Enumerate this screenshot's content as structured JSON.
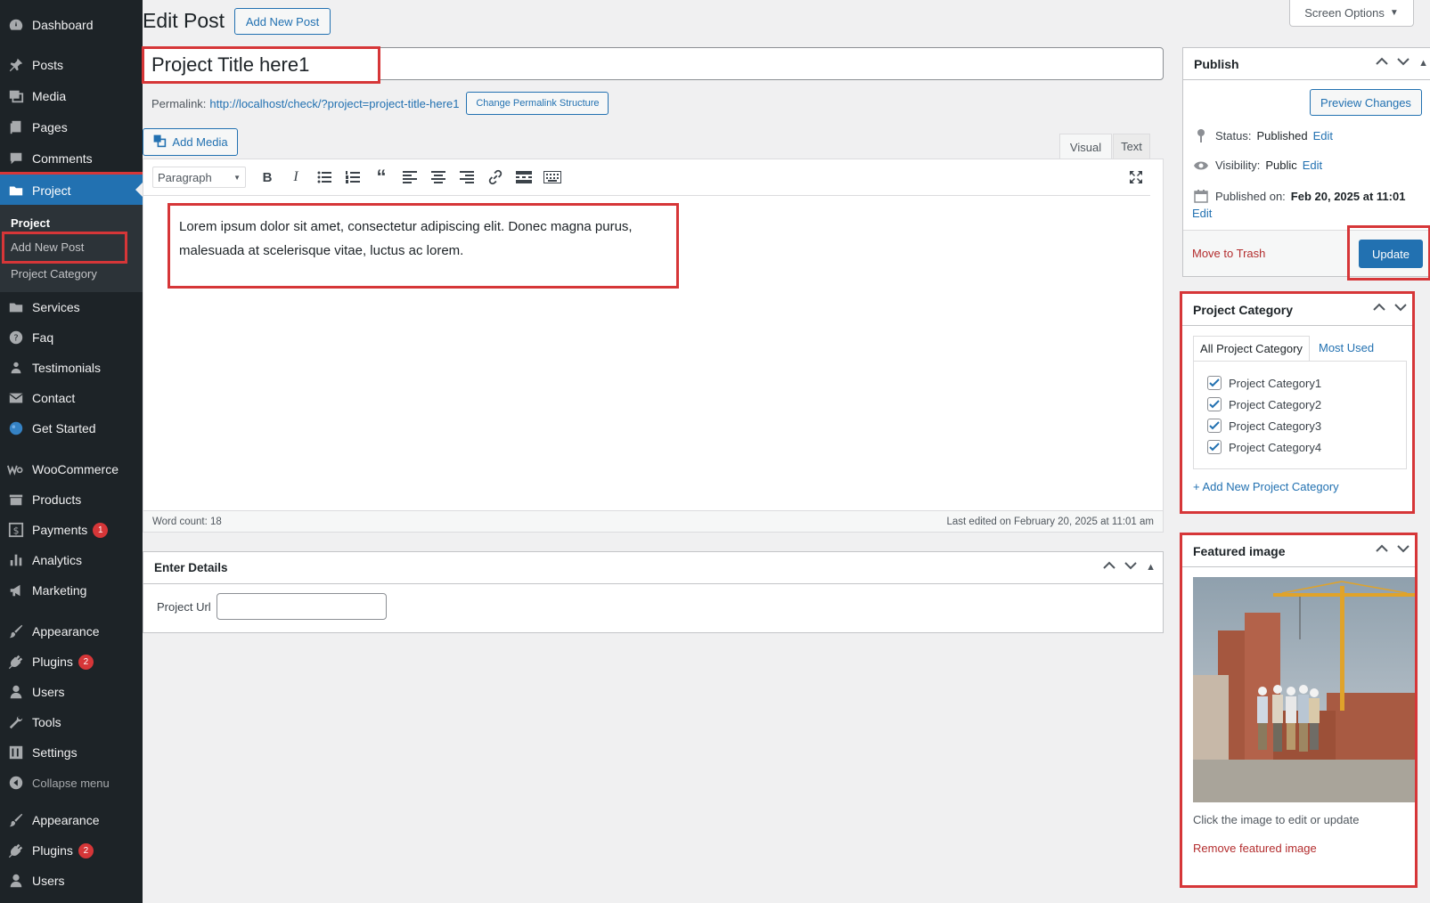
{
  "sidebar": {
    "items": [
      {
        "label": "Dashboard",
        "icon": "dashboard-icon"
      },
      {
        "label": "Posts",
        "icon": "pin-icon"
      },
      {
        "label": "Media",
        "icon": "media-icon"
      },
      {
        "label": "Pages",
        "icon": "pages-icon"
      },
      {
        "label": "Comments",
        "icon": "comment-icon"
      },
      {
        "label": "Project",
        "icon": "folder-icon"
      },
      {
        "label": "Services",
        "icon": "folder-icon"
      },
      {
        "label": "Faq",
        "icon": "help-icon"
      },
      {
        "label": "Testimonials",
        "icon": "users-icon"
      },
      {
        "label": "Contact",
        "icon": "mail-icon"
      },
      {
        "label": "Get Started",
        "icon": "globe-icon"
      },
      {
        "label": "WooCommerce",
        "icon": "woo-icon"
      },
      {
        "label": "Products",
        "icon": "archive-icon"
      },
      {
        "label": "Payments",
        "icon": "dollar-icon",
        "badge": "1"
      },
      {
        "label": "Analytics",
        "icon": "bar-chart-icon"
      },
      {
        "label": "Marketing",
        "icon": "megaphone-icon"
      },
      {
        "label": "Appearance",
        "icon": "brush-icon"
      },
      {
        "label": "Plugins",
        "icon": "plug-icon",
        "badge": "2"
      },
      {
        "label": "Users",
        "icon": "user-icon"
      },
      {
        "label": "Tools",
        "icon": "wrench-icon"
      },
      {
        "label": "Settings",
        "icon": "settings-icon"
      },
      {
        "label": "Collapse menu",
        "icon": "collapse-icon"
      },
      {
        "label": "Appearance",
        "icon": "brush-icon"
      },
      {
        "label": "Plugins",
        "icon": "plug-icon",
        "badge": "2"
      },
      {
        "label": "Users",
        "icon": "user-icon"
      }
    ],
    "submenu": {
      "title": "Project",
      "add_new": "Add New Post",
      "category": "Project Category"
    }
  },
  "header": {
    "title": "Edit Post",
    "add_new": "Add New Post",
    "screen_options": "Screen Options"
  },
  "post": {
    "title": "Project Title here1",
    "permalink_label": "Permalink:",
    "permalink_url": "http://localhost/check/?project=project-title-here1",
    "change_permalink": "Change Permalink Structure",
    "add_media": "Add Media",
    "tab_visual": "Visual",
    "tab_text": "Text",
    "format": "Paragraph",
    "content": "Lorem ipsum dolor sit amet, consectetur adipiscing elit. Donec magna purus, malesuada at scelerisque vitae, luctus ac lorem.",
    "word_count": "Word count: 18",
    "last_edited": "Last edited on February 20, 2025 at 11:01 am"
  },
  "details": {
    "title": "Enter Details",
    "url_label": "Project Url",
    "url_value": ""
  },
  "publish": {
    "title": "Publish",
    "preview": "Preview Changes",
    "status_label": "Status:",
    "status_value": "Published",
    "visibility_label": "Visibility:",
    "visibility_value": "Public",
    "published_label": "Published on:",
    "published_value": "Feb 20, 2025 at 11:01",
    "edit": "Edit",
    "trash": "Move to Trash",
    "update": "Update"
  },
  "category": {
    "title": "Project Category",
    "tab_all": "All Project Category",
    "tab_most": "Most Used",
    "items": [
      "Project Category1",
      "Project Category2",
      "Project Category3",
      "Project Category4"
    ],
    "add_new": "+ Add New Project Category"
  },
  "featured": {
    "title": "Featured image",
    "hint": "Click the image to edit or update",
    "remove": "Remove featured image"
  },
  "colors": {
    "sidebar_bg": "#1d2327",
    "accent": "#2271b1",
    "highlight": "#d63638"
  }
}
